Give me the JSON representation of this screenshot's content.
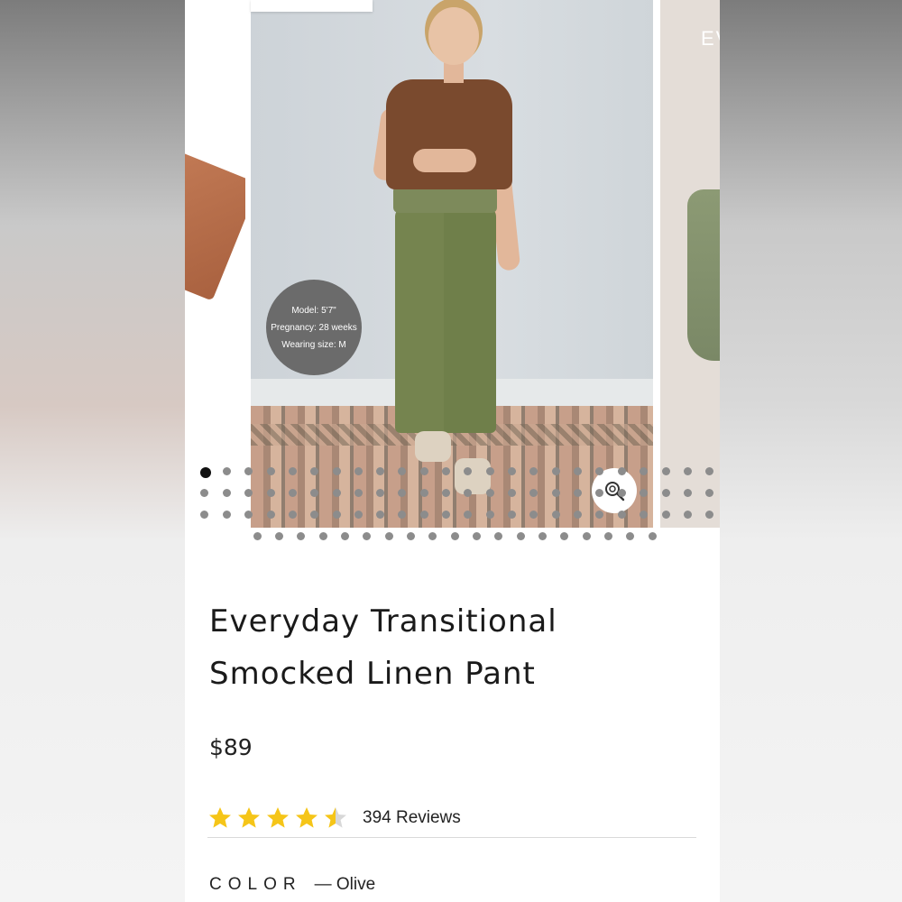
{
  "carousel": {
    "next_slide_text": "EV",
    "model_info": {
      "line1": "Model: 5'7\"",
      "line2": "Pregnancy: 28 weeks",
      "line3": "Wearing size: M"
    },
    "active_dot_index": 0,
    "zoom_icon": "zoom-in-icon"
  },
  "product": {
    "title_line1": "Everyday Transitional",
    "title_line2": "Smocked Linen Pant",
    "price": "$89",
    "rating": 4.5,
    "reviews_label": "394 Reviews",
    "color_label": "COLOR",
    "color_value": "— Olive"
  },
  "colors": {
    "star_filled": "#f5c518",
    "star_empty": "#d8d8d8",
    "badge_bg": "#6b6b6b"
  }
}
